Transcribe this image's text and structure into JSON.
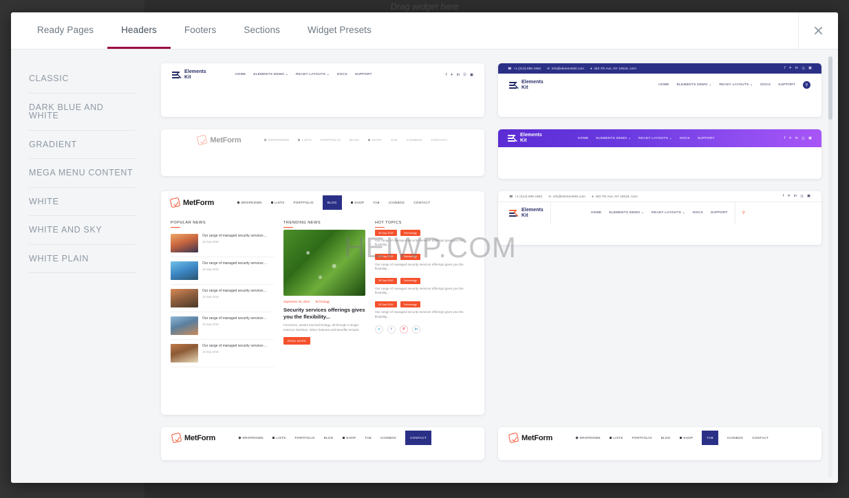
{
  "editor": {
    "drag_hint": "Drag widget here"
  },
  "watermark": "HEIWP.COM",
  "modal": {
    "tabs": [
      {
        "label": "Ready Pages",
        "active": false
      },
      {
        "label": "Headers",
        "active": true
      },
      {
        "label": "Footers",
        "active": false
      },
      {
        "label": "Sections",
        "active": false
      },
      {
        "label": "Widget Presets",
        "active": false
      }
    ],
    "close_label": "×",
    "accent_color": "#9b0a46"
  },
  "sidebar": {
    "items": [
      {
        "label": "CLASSIC"
      },
      {
        "label": "DARK BLUE AND WHITE"
      },
      {
        "label": "GRADIENT"
      },
      {
        "label": "MEGA MENU CONTENT"
      },
      {
        "label": "WHITE"
      },
      {
        "label": "WHITE AND SKY"
      },
      {
        "label": "WHITE PLAIN"
      }
    ]
  },
  "brand": {
    "elementskit_line1": "Elements",
    "elementskit_line2": "Kit",
    "metform": "MetForm"
  },
  "contact": {
    "phone": "+1 (212)-695-1962",
    "email": "info@elementskit.com",
    "address": "463 7th Ave, NY 10018, USA"
  },
  "nav_ek": [
    {
      "label": "HOME"
    },
    {
      "label": "ELEMENTS DEMO ⌄"
    },
    {
      "label": "READY LAYOUTS ⌄"
    },
    {
      "label": "DOCS"
    },
    {
      "label": "SUPPORT"
    }
  ],
  "social": [
    {
      "name": "facebook",
      "glyph": "f"
    },
    {
      "name": "twitter",
      "glyph": "✈"
    },
    {
      "name": "linkedin",
      "glyph": "in"
    },
    {
      "name": "behance",
      "glyph": "ⓑ"
    },
    {
      "name": "instagram",
      "glyph": "▣"
    }
  ],
  "nav_mf": [
    {
      "label": "DROPDOWN",
      "icon": "diamond"
    },
    {
      "label": "LISTS",
      "icon": "square"
    },
    {
      "label": "PORTFOLIO",
      "icon": "none"
    },
    {
      "label": "BLOG",
      "icon": "none"
    },
    {
      "label": "SHOP",
      "icon": "square"
    },
    {
      "label": "TAB",
      "icon": "none"
    },
    {
      "label": "ICONBOX",
      "icon": "none"
    },
    {
      "label": "CONTACT",
      "icon": "none"
    }
  ],
  "mega": {
    "col1_title": "POPULAR NEWS",
    "col2_title": "TRENDING NEWS",
    "col3_title": "HOT TOPICS",
    "news": [
      {
        "headline": "Our range of managed security services ...",
        "date": "19 Sep 2019"
      },
      {
        "headline": "Our range of managed security services ...",
        "date": "19 Sep 2019"
      },
      {
        "headline": "Our range of managed security services ...",
        "date": "19 Sep 2019"
      },
      {
        "headline": "Our range of managed security services ...",
        "date": "19 Sep 2019"
      },
      {
        "headline": "Our range of managed security services ...",
        "date": "19 Sep 2019"
      }
    ],
    "article": {
      "date": "September 25, 2019",
      "category": "Technology",
      "title": "Security services offerings gives you the flexibility...",
      "body": "Functions, assets and technology, all through a single intercon interface. Other features and benefits include:",
      "cta": "READ MORE"
    },
    "hot_topics": [
      {
        "date": "25 Sep 2019",
        "category": "Technology",
        "text": "Our range of managed security services offerings gives you the flexibility..."
      },
      {
        "date": "25 Sep 2019",
        "category": "Technology",
        "text": "Our range of managed security services offerings gives you the flexibility..."
      },
      {
        "date": "25 Sep 2019",
        "category": "Technology",
        "text": "Our range of managed security services offerings gives you the flexibility..."
      },
      {
        "date": "25 Sep 2019",
        "category": "Technology",
        "text": "Our range of managed security services offerings gives you the flexibility..."
      }
    ],
    "social_circles": [
      {
        "name": "twitter",
        "glyph": "✈"
      },
      {
        "name": "facebook",
        "glyph": "f"
      },
      {
        "name": "pinterest",
        "glyph": "P"
      },
      {
        "name": "linkedin",
        "glyph": "in"
      }
    ]
  },
  "templates": [
    {
      "id": "classic-simple",
      "style": "classic"
    },
    {
      "id": "dark-blue-topbar",
      "style": "darkblue"
    },
    {
      "id": "metform-faded",
      "style": "metform-plain"
    },
    {
      "id": "gradient-purple",
      "style": "gradient"
    },
    {
      "id": "mega-menu-content",
      "style": "mega"
    },
    {
      "id": "white-plain-search",
      "style": "white-search"
    },
    {
      "id": "metform-contact-active",
      "style": "metform-contact"
    },
    {
      "id": "metform-tab-active",
      "style": "metform-tab"
    }
  ]
}
